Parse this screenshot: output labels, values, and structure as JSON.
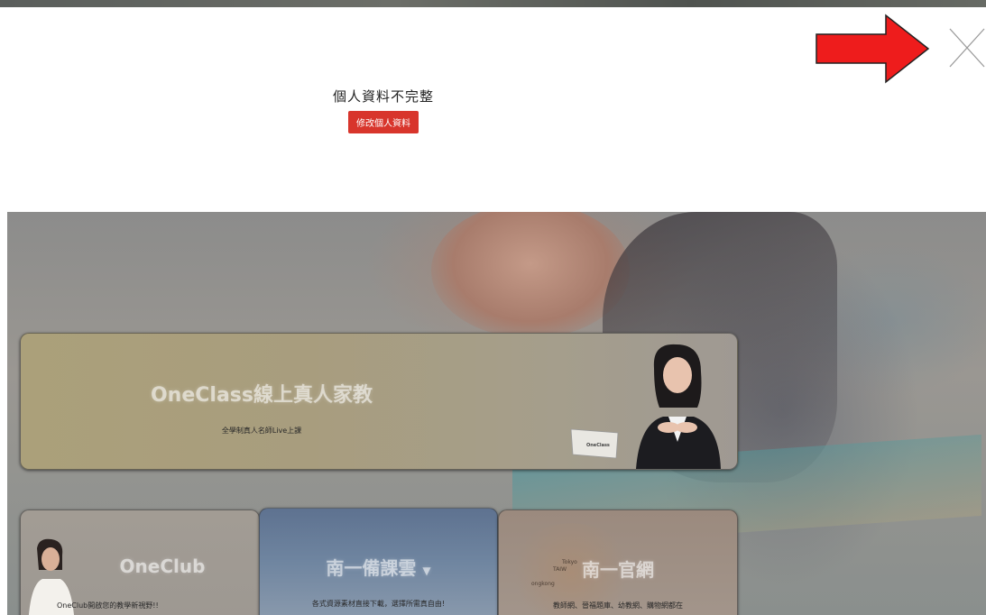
{
  "notice": {
    "title": "個人資料不完整",
    "button_label": "修改個人資料"
  },
  "colors": {
    "button": "#d8352c",
    "arrow": "#ee1c1c",
    "close_icon": "#9a9a9a"
  },
  "icons": {
    "arrow": "red-arrow-icon",
    "close": "close-icon"
  },
  "cards": {
    "main": {
      "title": "OneClass線上真人家教",
      "subtitle": "全學制真人名師Live上課",
      "laptop_logo": "OneClass"
    },
    "oneclub": {
      "title": "OneClub",
      "subtitle": "OneClub開啟您的教學新視野!!"
    },
    "cloud": {
      "title": "南一備課雲",
      "subtitle": "各式資源素材直接下載，選擇所需真自由!"
    },
    "official": {
      "title": "南一官網",
      "subtitle": "教師網、晉福題庫、幼教網、購物網都在",
      "map_labels": [
        "TAIW",
        "Tokyo",
        "ongkong"
      ]
    }
  }
}
